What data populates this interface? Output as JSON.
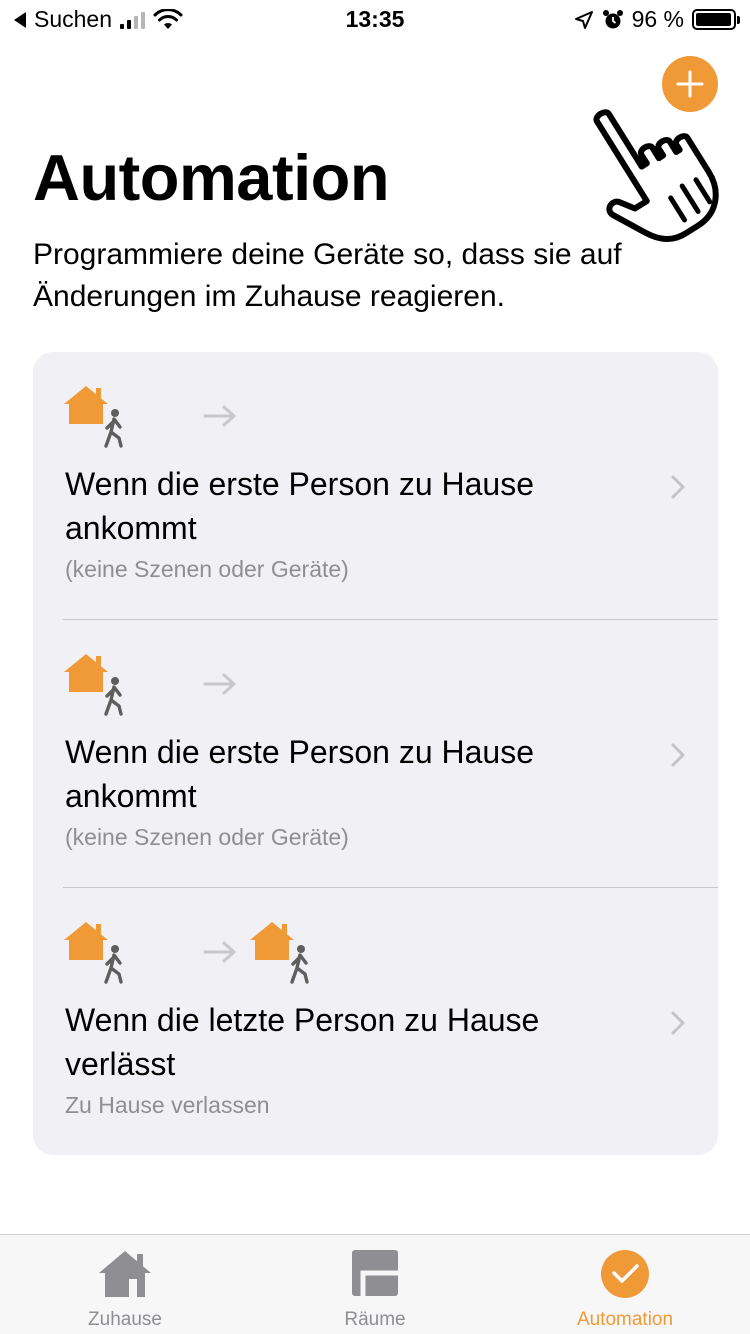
{
  "status_bar": {
    "back_label": "Suchen",
    "time": "13:35",
    "battery_percent": "96 %",
    "battery_level": 0.96
  },
  "header": {
    "title": "Automation",
    "subtitle": "Programmiere deine Geräte so, dass sie auf Änderungen im Zuhause reagieren."
  },
  "colors": {
    "accent": "#f09a37",
    "secondary_text": "#8e8e93",
    "card_bg": "#f1f1f5"
  },
  "automations": [
    {
      "title": "Wenn die erste Person zu Hause ankommt",
      "subtitle": "(keine Szenen oder Geräte)",
      "icons": [
        "home-icon",
        "person-walking-icon",
        "arrow-right-icon"
      ]
    },
    {
      "title": "Wenn die erste Person zu Hause ankommt",
      "subtitle": "(keine Szenen oder Geräte)",
      "icons": [
        "home-icon",
        "person-walking-icon",
        "arrow-right-icon"
      ]
    },
    {
      "title": "Wenn die letzte Person zu Hause verlässt",
      "subtitle": "Zu Hause verlassen",
      "icons": [
        "home-icon",
        "person-walking-icon",
        "arrow-right-icon",
        "home-icon",
        "person-walking-icon"
      ]
    }
  ],
  "tab_bar": {
    "tabs": [
      {
        "label": "Zuhause",
        "icon": "home-tab-icon",
        "active": false
      },
      {
        "label": "Räume",
        "icon": "rooms-tab-icon",
        "active": false
      },
      {
        "label": "Automation",
        "icon": "automation-tab-icon",
        "active": true
      }
    ]
  }
}
